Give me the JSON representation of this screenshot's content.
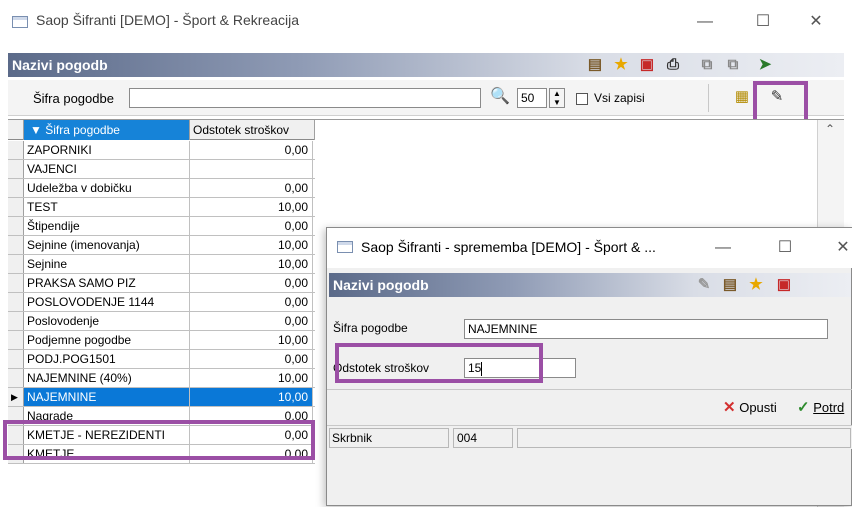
{
  "main_window": {
    "title": "Saop Šifranti [DEMO] - Šport & Rekreacija",
    "controls": {
      "minimize": "—",
      "maximize": "☐",
      "close": "✕"
    },
    "banner": "Nazivi pogodb",
    "toolbar_icons": [
      "grid-icon",
      "star-icon",
      "pdf-icon",
      "print-icon",
      "copy-icon",
      "paste-icon",
      "exit-icon"
    ],
    "filter": {
      "label": "Šifra pogodbe",
      "value": "",
      "count": "50",
      "all_records_label": "Vsi zapisi",
      "all_records_checked": false
    },
    "grid": {
      "columns": [
        "▼ Šifra pogodbe",
        "Odstotek stroškov"
      ],
      "rows": [
        {
          "name": "ZAPORNIKI",
          "pct": "0,00"
        },
        {
          "name": "VAJENCI",
          "pct": ""
        },
        {
          "name": "Udeležba v dobičku",
          "pct": "0,00"
        },
        {
          "name": "TEST",
          "pct": "10,00"
        },
        {
          "name": "Štipendije",
          "pct": "0,00"
        },
        {
          "name": "Sejnine (imenovanja)",
          "pct": "10,00"
        },
        {
          "name": "Sejnine",
          "pct": "10,00"
        },
        {
          "name": "PRAKSA SAMO PIZ",
          "pct": "0,00"
        },
        {
          "name": "POSLOVODENJE 1144",
          "pct": "0,00"
        },
        {
          "name": "Poslovodenje",
          "pct": "0,00"
        },
        {
          "name": "Podjemne pogodbe",
          "pct": "10,00"
        },
        {
          "name": "PODJ.POG1501",
          "pct": "0,00"
        },
        {
          "name": "NAJEMNINE (40%)",
          "pct": "10,00"
        },
        {
          "name": "NAJEMNINE",
          "pct": "10,00",
          "selected": true
        },
        {
          "name": "Nagrade",
          "pct": "0,00"
        },
        {
          "name": "KMETJE - NEREZIDENTI",
          "pct": "0,00"
        },
        {
          "name": "KMETJE",
          "pct": "0,00"
        }
      ]
    }
  },
  "dialog": {
    "title": "Saop Šifranti - sprememba [DEMO] - Šport & ...",
    "controls": {
      "minimize": "—",
      "maximize": "☐",
      "close": "✕"
    },
    "banner": "Nazivi pogodb",
    "fields": {
      "sifra_label": "Šifra pogodbe",
      "sifra_value": "NAJEMNINE",
      "odstotek_label": "Odstotek stroškov",
      "odstotek_value": "15"
    },
    "buttons": {
      "cancel": "Opusti",
      "confirm": "Potrd"
    },
    "footer": {
      "skrbnik_label": "Skrbnik",
      "skrbnik_value": "004"
    }
  },
  "colors": {
    "highlight": "#9b4fa5",
    "selection": "#0a78d7"
  }
}
